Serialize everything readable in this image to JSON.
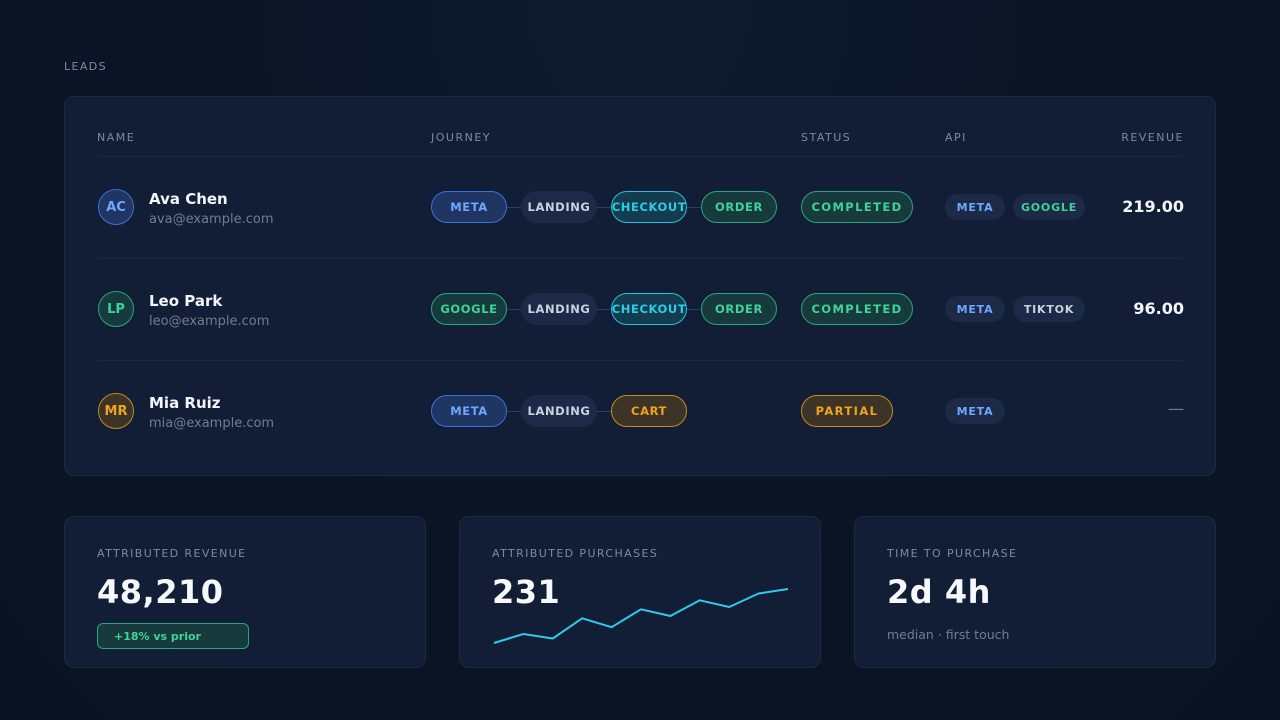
{
  "section_title": "LEADS",
  "columns": {
    "name": "NAME",
    "journey": "JOURNEY",
    "status": "STATUS",
    "api": "API",
    "revenue": "REVENUE"
  },
  "leads": [
    {
      "initials": "AC",
      "name": "Ava Chen",
      "email": "ava@example.com",
      "journey": [
        "META",
        "LANDING",
        "CHECKOUT",
        "ORDER"
      ],
      "status": "COMPLETED",
      "api": [
        "META",
        "GOOGLE"
      ],
      "revenue": "219.00"
    },
    {
      "initials": "LP",
      "name": "Leo Park",
      "email": "leo@example.com",
      "journey": [
        "GOOGLE",
        "LANDING",
        "CHECKOUT",
        "ORDER"
      ],
      "status": "COMPLETED",
      "api": [
        "META",
        "TIKTOK"
      ],
      "revenue": "96.00"
    },
    {
      "initials": "MR",
      "name": "Mia Ruiz",
      "email": "mia@example.com",
      "journey": [
        "META",
        "LANDING",
        "CART"
      ],
      "status": "PARTIAL",
      "api": [
        "META"
      ],
      "revenue": "—"
    }
  ],
  "cards": {
    "revenue": {
      "label": "ATTRIBUTED REVENUE",
      "value": "48,210",
      "delta": "+18% vs prior"
    },
    "purchases": {
      "label": "ATTRIBUTED PURCHASES",
      "value": "231",
      "sparkline": [
        22,
        26,
        24,
        33,
        29,
        37,
        34,
        41,
        38,
        44,
        46
      ]
    },
    "time": {
      "label": "TIME TO PURCHASE",
      "value": "2d 4h",
      "sub": "median · first touch"
    }
  },
  "colors": {
    "meta": "#6ea8ff",
    "google": "#3fd39a",
    "checkout": "#30cbe8",
    "partial": "#f0a51f",
    "sparkline": "#30cbe8"
  }
}
